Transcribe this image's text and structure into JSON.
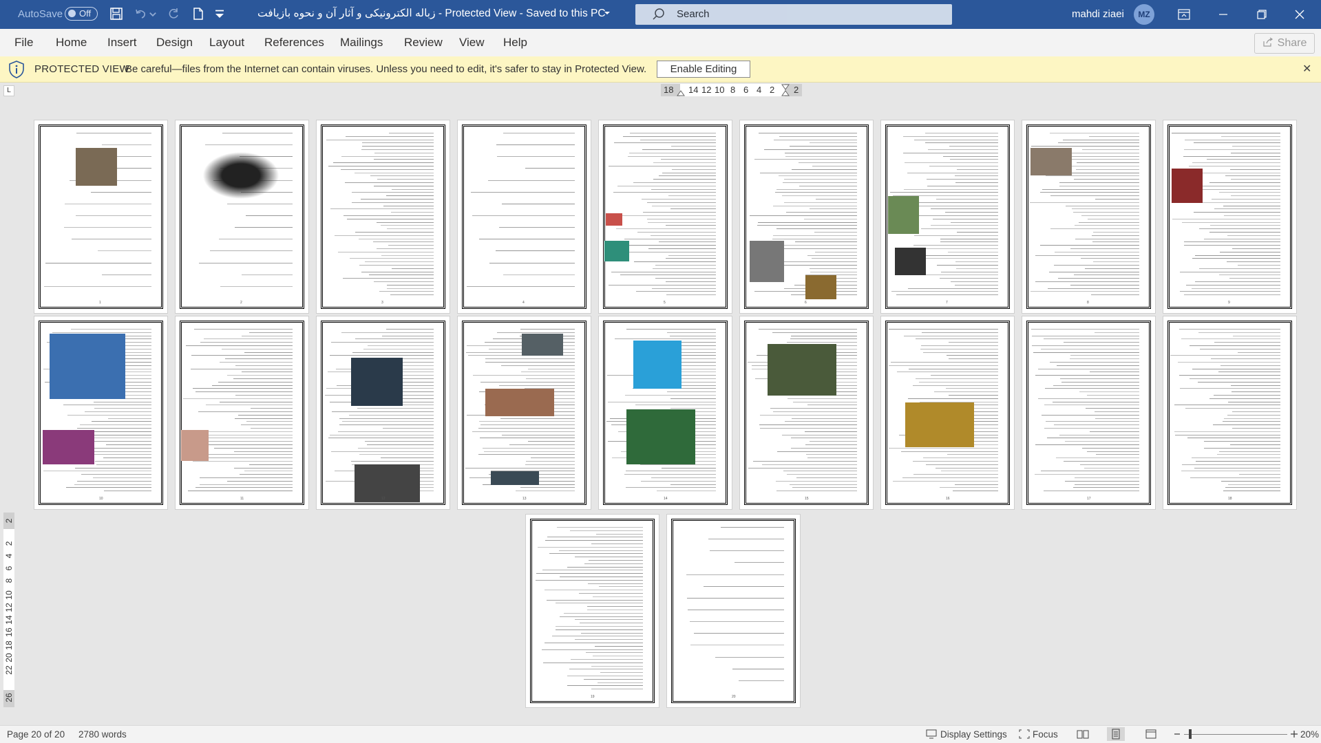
{
  "titlebar": {
    "autosave_label": "AutoSave",
    "autosave_state": "Off",
    "document_title": "زباله الکترونیکی و آثار آن و نحوه بازیافت  -  Protected View  -  Saved to this PC",
    "search_placeholder": "Search",
    "user_name": "mahdi ziaei",
    "user_initials": "MZ"
  },
  "menu": {
    "items": [
      "File",
      "Home",
      "Insert",
      "Design",
      "Layout",
      "References",
      "Mailings",
      "Review",
      "View",
      "Help"
    ],
    "share_label": "Share"
  },
  "protected_view": {
    "title": "PROTECTED VIEW",
    "message": "Be careful—files from the Internet can contain viruses. Unless you need to edit, it's safer to stay in Protected View.",
    "enable_button": "Enable Editing"
  },
  "ruler": {
    "horizontal_labels": [
      "18",
      "14",
      "12",
      "10",
      "8",
      "6",
      "4",
      "2",
      "2"
    ],
    "vertical_labels": [
      "2",
      "2",
      "4",
      "6",
      "8",
      "10",
      "12",
      "14",
      "16",
      "18",
      "20",
      "22",
      "26"
    ]
  },
  "pages": {
    "count": 20,
    "page_numbers": [
      "1",
      "2",
      "3",
      "4",
      "5",
      "6",
      "7",
      "8",
      "9",
      "10",
      "11",
      "12",
      "13",
      "14",
      "15",
      "16",
      "17",
      "18",
      "19",
      "20"
    ]
  },
  "statusbar": {
    "page_info": "Page 20 of 20",
    "word_count": "2780 words",
    "display_settings": "Display Settings",
    "focus": "Focus",
    "zoom": "20%"
  },
  "colors": {
    "titlebar": "#2b579a",
    "menubar": "#f3f3f3",
    "protected_bar": "#fdf6c3",
    "canvas": "#e6e6e6"
  }
}
